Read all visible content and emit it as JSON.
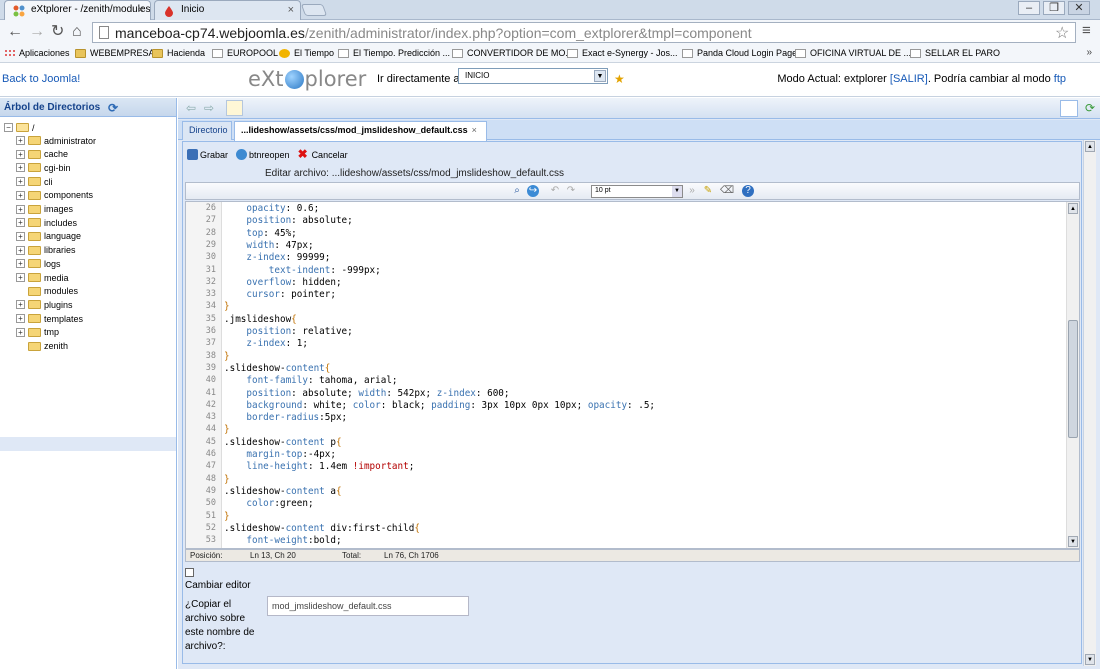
{
  "browser": {
    "tabs": [
      {
        "title": "eXtplorer - /zenith/modules/r"
      },
      {
        "title": "Inicio"
      }
    ],
    "address": {
      "host": "manceboa-cp74.webjoomla.es",
      "path": "/zenith/administrator/index.php?option=com_extplorer&tmpl=component"
    },
    "bookmarks": [
      "Aplicaciones",
      "WEBEMPRESA",
      "Hacienda",
      "EUROPOOL",
      "El Tiempo",
      "El Tiempo. Predicción ...",
      "CONVERTIDOR DE MO...",
      "Exact e-Synergy - Jos...",
      "Panda Cloud Login Page",
      "OFICINA VIRTUAL DE ...",
      "SELLAR EL PARO"
    ],
    "bookmarks_more": "»"
  },
  "header": {
    "back_link": "Back to Joomla!",
    "logo_left": "eXt",
    "logo_right": "plorer",
    "goto_label": "Ir directamente a:",
    "goto_value": "INICIO",
    "mode_text": "Modo Actual: extplorer",
    "mode_exit": "[SALIR]",
    "mode_change": ". Podría cambiar al modo",
    "mode_ftp": "ftp"
  },
  "tree": {
    "title": "Árbol de Directorios",
    "root": "/",
    "folders": [
      "administrator",
      "cache",
      "cgi-bin",
      "cli",
      "components",
      "images",
      "includes",
      "language",
      "libraries",
      "logs",
      "media",
      "modules",
      "plugins",
      "templates",
      "tmp",
      "zenith"
    ],
    "expandable": [
      true,
      true,
      true,
      true,
      true,
      true,
      true,
      true,
      true,
      true,
      true,
      false,
      true,
      true,
      true,
      false
    ],
    "selected": "zenith"
  },
  "main": {
    "tabs": [
      {
        "label": "Directorio"
      },
      {
        "label": "...lideshow/assets/css/mod_jmslideshow_default.css",
        "close": "×"
      }
    ],
    "actions": {
      "save": "Grabar",
      "reopen": "btnreopen",
      "cancel": "Cancelar"
    },
    "edit_file": "Editar archivo: ...lideshow/assets/css/mod_jmslideshow_default.css",
    "font_size": "10 pt",
    "status": {
      "pos_label": "Posición:",
      "pos_value": "Ln 13, Ch 20",
      "total_label": "Total:",
      "total_value": "Ln 76, Ch 1706"
    },
    "change_editor": "Cambiar editor",
    "copy_label": "¿Copiar el archivo sobre este nombre de archivo?:",
    "copy_value": "mod_jmslideshow_default.css"
  },
  "code": {
    "lines": [
      {
        "n": "26",
        "html": "    <span class='p'>opacity</span>: 0.6;"
      },
      {
        "n": "27",
        "html": "    <span class='p'>position</span>: absolute;"
      },
      {
        "n": "28",
        "html": "    <span class='p'>top</span>: 45%;"
      },
      {
        "n": "29",
        "html": "    <span class='p'>width</span>: 47px;"
      },
      {
        "n": "30",
        "html": "    <span class='p'>z-index</span>: 99999;"
      },
      {
        "n": "31",
        "html": "        <span class='p'>text-indent</span>: -999px;"
      },
      {
        "n": "32",
        "html": "    <span class='p'>overflow</span>: hidden;"
      },
      {
        "n": "33",
        "html": "    <span class='p'>cursor</span>: pointer;"
      },
      {
        "n": "34",
        "html": "<span class='b'>}</span>"
      },
      {
        "n": "35",
        "html": ".jmslideshow<span class='b'>{</span>"
      },
      {
        "n": "36",
        "html": "    <span class='p'>position</span>: relative;"
      },
      {
        "n": "37",
        "html": "    <span class='p'>z-index</span>: 1;"
      },
      {
        "n": "38",
        "html": "<span class='b'>}</span>"
      },
      {
        "n": "39",
        "html": ".slideshow-<span class='p'>content</span><span class='b'>{</span>"
      },
      {
        "n": "40",
        "html": "    <span class='p'>font-family</span>: tahoma, arial;"
      },
      {
        "n": "41",
        "html": "    <span class='p'>position</span>: absolute; <span class='p'>width</span>: 542px; <span class='p'>z-index</span>: 600;"
      },
      {
        "n": "42",
        "html": "    <span class='p'>background</span>: white; <span class='p'>color</span>: black; <span class='p'>padding</span>: 3px 10px 0px 10px; <span class='p'>opacity</span>: .5;"
      },
      {
        "n": "43",
        "html": "    <span class='p'>border-radius</span>:5px;"
      },
      {
        "n": "44",
        "html": "<span class='b'>}</span>"
      },
      {
        "n": "45",
        "html": ".slideshow-<span class='p'>content</span> p<span class='b'>{</span>"
      },
      {
        "n": "46",
        "html": "    <span class='p'>margin-top</span>:-4px;"
      },
      {
        "n": "47",
        "html": "    <span class='p'>line-height</span>: 1.4em <span class='im'>!important</span>;"
      },
      {
        "n": "48",
        "html": "<span class='b'>}</span>"
      },
      {
        "n": "49",
        "html": ".slideshow-<span class='p'>content</span> a<span class='b'>{</span>"
      },
      {
        "n": "50",
        "html": "    <span class='p'>color</span>:green;"
      },
      {
        "n": "51",
        "html": "<span class='b'>}</span>"
      },
      {
        "n": "52",
        "html": ".slideshow-<span class='p'>content</span> div:first-child<span class='b'>{</span>"
      },
      {
        "n": "53",
        "html": "    <span class='p'>font-weight</span>:bold;"
      }
    ]
  },
  "colors": {
    "accent": "#15428b",
    "panel": "#dfe8f6",
    "border": "#99bbe8",
    "link": "#1659b7"
  }
}
